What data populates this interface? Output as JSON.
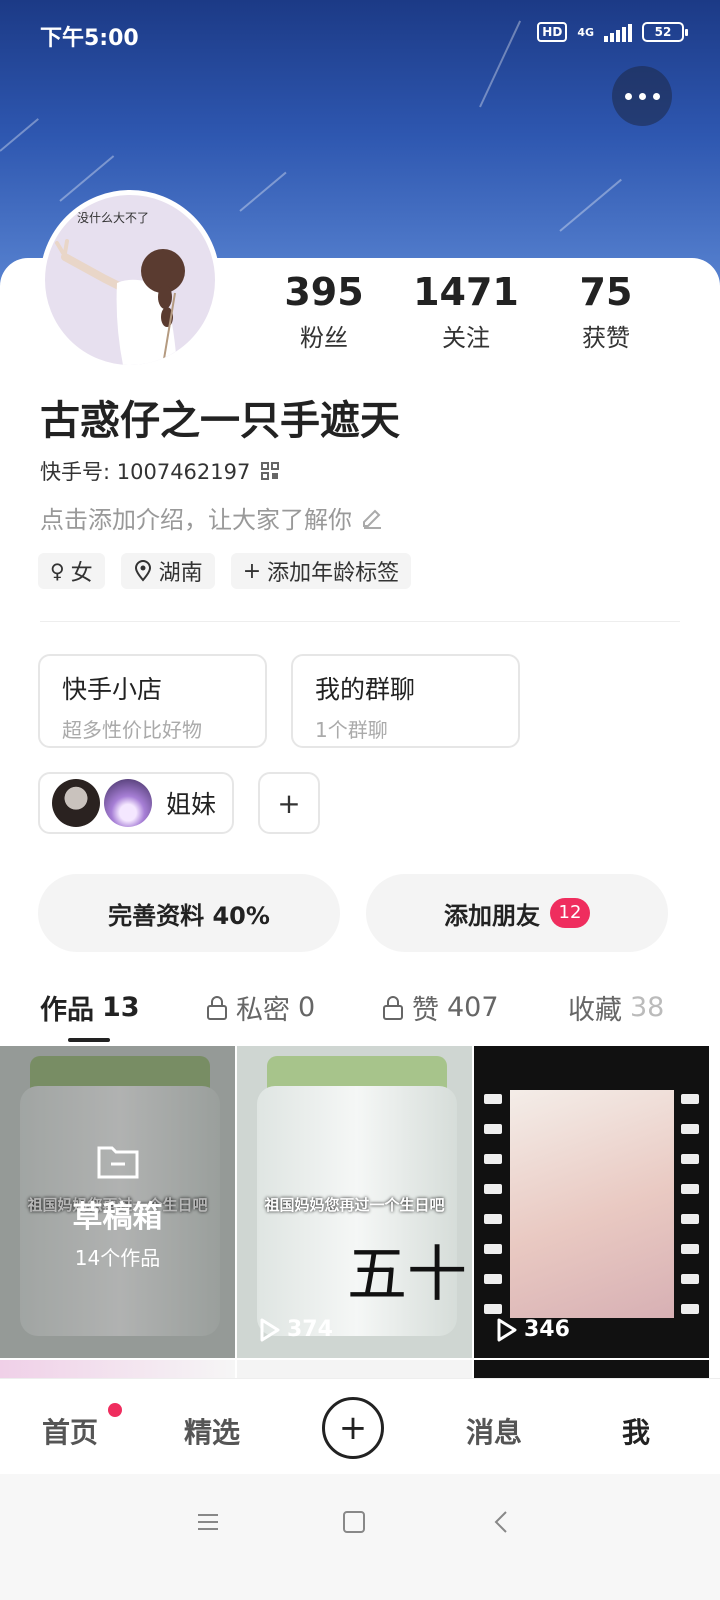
{
  "status_bar": {
    "time": "下午5:00",
    "hd": "HD",
    "network": "4G",
    "battery": "52"
  },
  "profile": {
    "avatar_text": "没什么大不了",
    "username": "古惑仔之一只手遮天",
    "kuaishou_id_label": "快手号: 1007462197",
    "bio_placeholder": "点击添加介绍，让大家了解你",
    "stats": [
      {
        "value": "395",
        "label": "粉丝"
      },
      {
        "value": "1471",
        "label": "关注"
      },
      {
        "value": "75",
        "label": "获赞"
      }
    ],
    "tags": {
      "gender": "女",
      "location": "湖南",
      "age": "添加年龄标签"
    }
  },
  "features": {
    "shop": {
      "title": "快手小店",
      "subtitle": "超多性价比好物"
    },
    "group_chat": {
      "title": "我的群聊",
      "subtitle": "1个群聊"
    },
    "sisters_label": "姐妹",
    "add_label": "+"
  },
  "actions": {
    "complete_profile": "完善资料 40%",
    "add_friends": "添加朋友",
    "add_friends_badge": "12"
  },
  "tabs": [
    {
      "label": "作品",
      "count": "13"
    },
    {
      "label": "私密",
      "count": "0"
    },
    {
      "label": "赞",
      "count": "407"
    },
    {
      "label": "收藏",
      "count": "38"
    }
  ],
  "grid": {
    "draft_title": "草稿箱",
    "draft_count": "14个作品",
    "caption": "祖国妈妈您再过一个生日吧",
    "video2_plays": "374",
    "video3_plays": "346"
  },
  "bottom_nav": {
    "home": "首页",
    "featured": "精选",
    "messages": "消息",
    "me": "我"
  },
  "colors": {
    "accent": "#ef2d5e",
    "header_top": "#1c3a86",
    "header_bottom": "#5b86d3"
  }
}
